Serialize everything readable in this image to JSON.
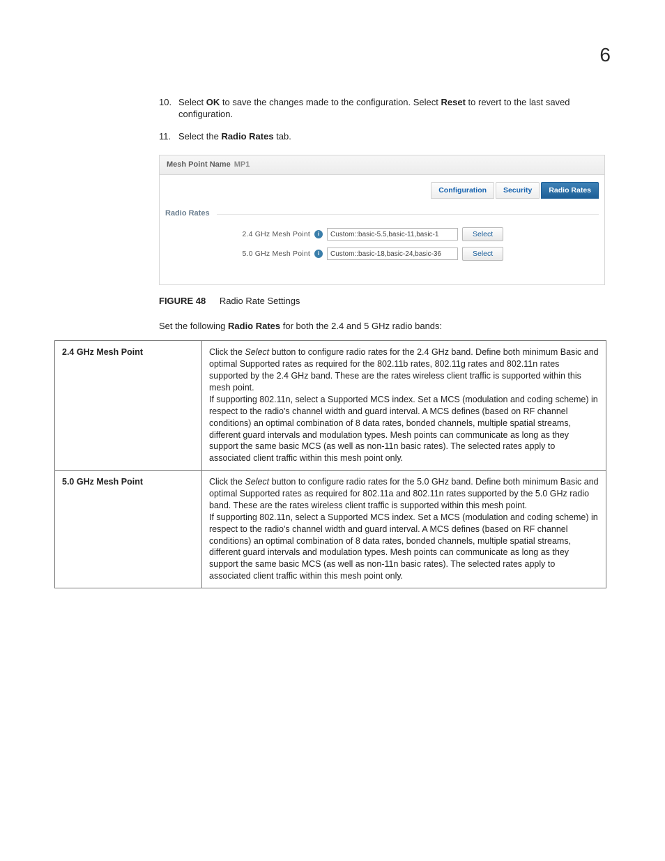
{
  "page_number": "6",
  "steps": {
    "s10": {
      "num": "10.",
      "t1": "Select ",
      "b1": "OK",
      "t2": " to save the changes made to the configuration. Select ",
      "b2": "Reset",
      "t3": " to revert to the last saved configuration."
    },
    "s11": {
      "num": "11.",
      "t1": "Select the ",
      "b1": "Radio Rates",
      "t2": " tab."
    }
  },
  "shot": {
    "header_label": "Mesh Point Name",
    "header_value": "MP1",
    "tabs": {
      "configuration": "Configuration",
      "security": "Security",
      "radio_rates": "Radio Rates"
    },
    "fieldset": "Radio Rates",
    "row24": {
      "label": "2.4 GHz Mesh Point",
      "value": "Custom::basic-5.5,basic-11,basic-1",
      "btn": "Select"
    },
    "row50": {
      "label": "5.0 GHz Mesh Point",
      "value": "Custom::basic-18,basic-24,basic-36",
      "btn": "Select"
    },
    "info_glyph": "i"
  },
  "figure": {
    "label": "FIGURE 48",
    "title": "Radio Rate Settings"
  },
  "lead": {
    "t1": "Set the following ",
    "b1": "Radio Rates",
    "t2": " for both the 2.4 and 5 GHz radio bands:"
  },
  "table": {
    "r1": {
      "term": "2.4 GHz Mesh Point",
      "p1a": "Click the ",
      "p1i": "Select",
      "p1b": " button to configure radio rates for the 2.4 GHz band. Define both minimum Basic and optimal Supported rates as required for the 802.11b rates, 802.11g rates and 802.11n rates supported by the 2.4 GHz band. These are the rates wireless client traffic is supported within this mesh point.",
      "p2": "If supporting 802.11n, select a Supported MCS index. Set a MCS (modulation and coding scheme) in respect to the radio's channel width and guard interval. A MCS defines (based on RF channel conditions) an optimal combination of 8 data rates, bonded channels, multiple spatial streams, different guard intervals and modulation types. Mesh points can communicate as long as they support the same basic MCS (as well as non-11n basic rates). The selected rates apply to associated client traffic within this mesh point only."
    },
    "r2": {
      "term": "5.0 GHz Mesh Point",
      "p1a": "Click the ",
      "p1i": "Select",
      "p1b": " button to configure radio rates for the 5.0 GHz band. Define both minimum Basic and optimal Supported rates as required for 802.11a and 802.11n rates supported by the 5.0 GHz radio band. These are the rates wireless client traffic is supported within this mesh point.",
      "p2": "If supporting 802.11n, select a Supported MCS index. Set a MCS (modulation and coding scheme) in respect to the radio's channel width and guard interval. A MCS defines (based on RF channel conditions) an optimal combination of 8 data rates, bonded channels, multiple spatial streams, different guard intervals and modulation types. Mesh points can communicate as long as they support the same basic MCS (as well as non-11n basic rates). The selected rates apply to associated client traffic within this mesh point only."
    }
  }
}
